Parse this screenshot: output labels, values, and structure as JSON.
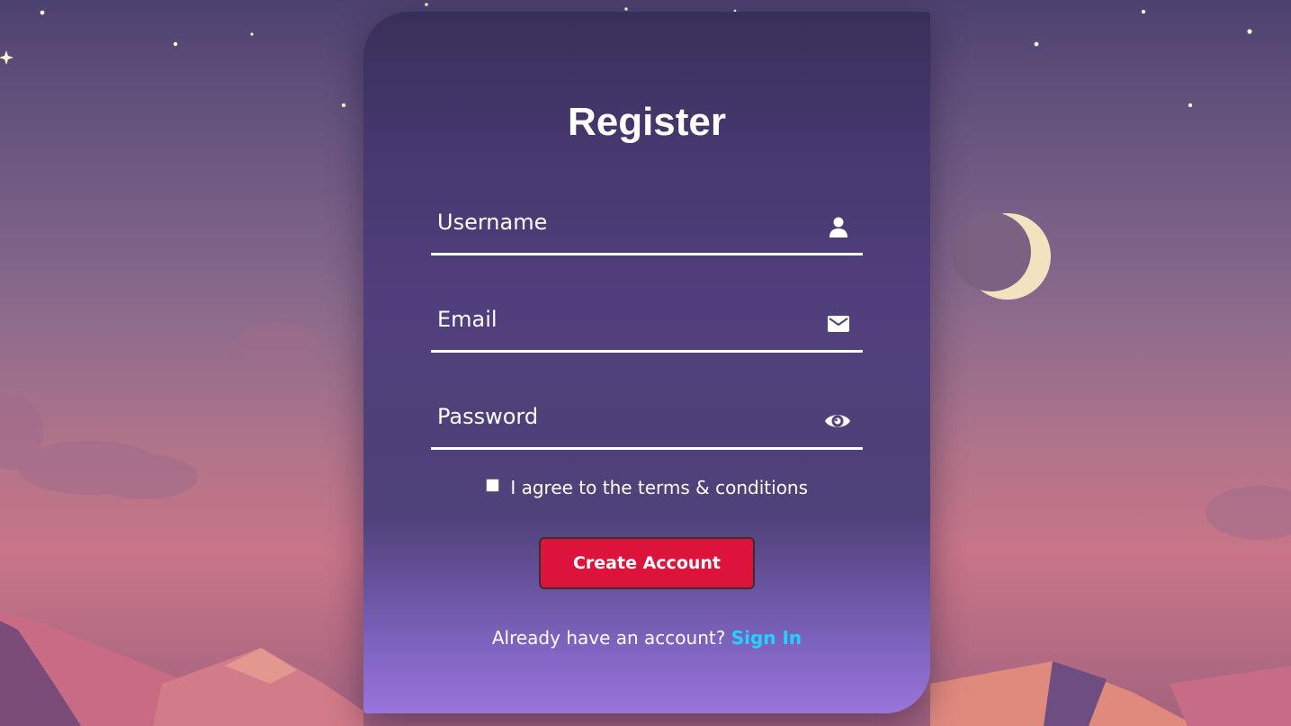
{
  "form": {
    "title": "Register",
    "username_placeholder": "Username",
    "email_placeholder": "Email",
    "password_placeholder": "Password",
    "terms_label": "I agree to the terms & conditions",
    "terms_checked": false,
    "submit_label": "Create Account",
    "signin_prompt": "Already have an account?",
    "signin_link": "Sign In"
  },
  "icons": {
    "username": "user-icon",
    "email": "envelope-icon",
    "password": "eye-icon"
  },
  "colors": {
    "button": "#dc143c",
    "link": "#1fd3ff",
    "text": "#ffffff"
  }
}
